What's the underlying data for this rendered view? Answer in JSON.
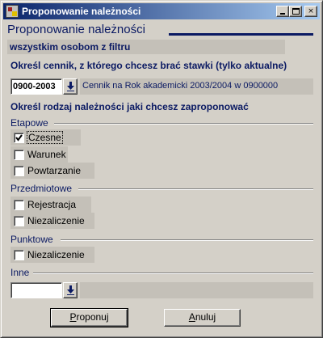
{
  "window": {
    "title": "Proponowanie należności",
    "icon": "app-icon",
    "controls": {
      "minimize": "minimize-icon",
      "maximize": "maximize-icon",
      "close": "×"
    }
  },
  "header": {
    "title": "Proponowanie należności",
    "filter_text": "wszystkim osobom z filtru"
  },
  "price_list": {
    "label": "Określ cennik, z którego chcesz brać stawki (tylko aktualne)",
    "code": "0900-2003",
    "description": "Cennik na Rok akademicki 2003/2004 w 0900000"
  },
  "charges": {
    "label": "Określ rodzaj należności jaki chcesz zaproponować",
    "groups": [
      {
        "label": "Etapowe",
        "items": [
          {
            "label": "Czesne",
            "checked": true
          },
          {
            "label": "Warunek",
            "checked": false
          },
          {
            "label": "Powtarzanie",
            "checked": false
          }
        ]
      },
      {
        "label": "Przedmiotowe",
        "items": [
          {
            "label": "Rejestracja",
            "checked": false
          },
          {
            "label": "Niezaliczenie",
            "checked": false
          }
        ]
      },
      {
        "label": "Punktowe",
        "items": [
          {
            "label": "Niezaliczenie",
            "checked": false
          }
        ]
      },
      {
        "label": "Inne",
        "items": []
      }
    ]
  },
  "inne": {
    "value": "",
    "description": ""
  },
  "buttons": {
    "propose": {
      "accel": "P",
      "rest": "roponuj"
    },
    "cancel": {
      "accel": "A",
      "rest": "nuluj"
    }
  },
  "colors": {
    "title_start": "#0a246a",
    "title_end": "#a6caf0",
    "accent": "#0b1a63",
    "face": "#d4d0c8"
  }
}
